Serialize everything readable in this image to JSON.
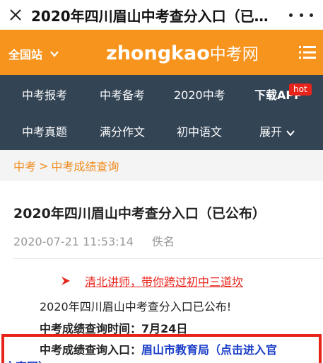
{
  "window": {
    "title": "2020年四川眉山中考查分入口（已…"
  },
  "header": {
    "region_label": "全国站",
    "logo_latin": "zhongkao",
    "logo_cn": "中考网",
    "brand_color": "#f7941d"
  },
  "nav": {
    "row1": [
      "中考报考",
      "中考备考",
      "2020中考",
      "下载APP"
    ],
    "row2": [
      "中考真题",
      "满分作文",
      "初中语文",
      "展开"
    ],
    "hot_badge": "hot"
  },
  "breadcrumb": {
    "home": "中考",
    "separator": ">",
    "current": "中考成绩查询"
  },
  "article": {
    "title": "2020年四川眉山中考查分入口（已公布）",
    "date": "2020-07-21 11:53:14",
    "author": "佚名",
    "promo_link": "清北讲师，带你跨过初中三道坎",
    "line1": "2020年四川眉山中考查分入口已公布!",
    "query_time_label": "中考成绩查询时间：",
    "query_time_value": "7月24日",
    "entry_label": "中考成绩查询入口：",
    "entry_link": "眉山市教育局（点击进入官",
    "entry_link_cont": "方官网）"
  },
  "colors": {
    "nav_bg": "#334455",
    "accent_red": "#e8231a",
    "link_blue": "#1a3dc8",
    "breadcrumb_orange": "#f08c1e"
  }
}
